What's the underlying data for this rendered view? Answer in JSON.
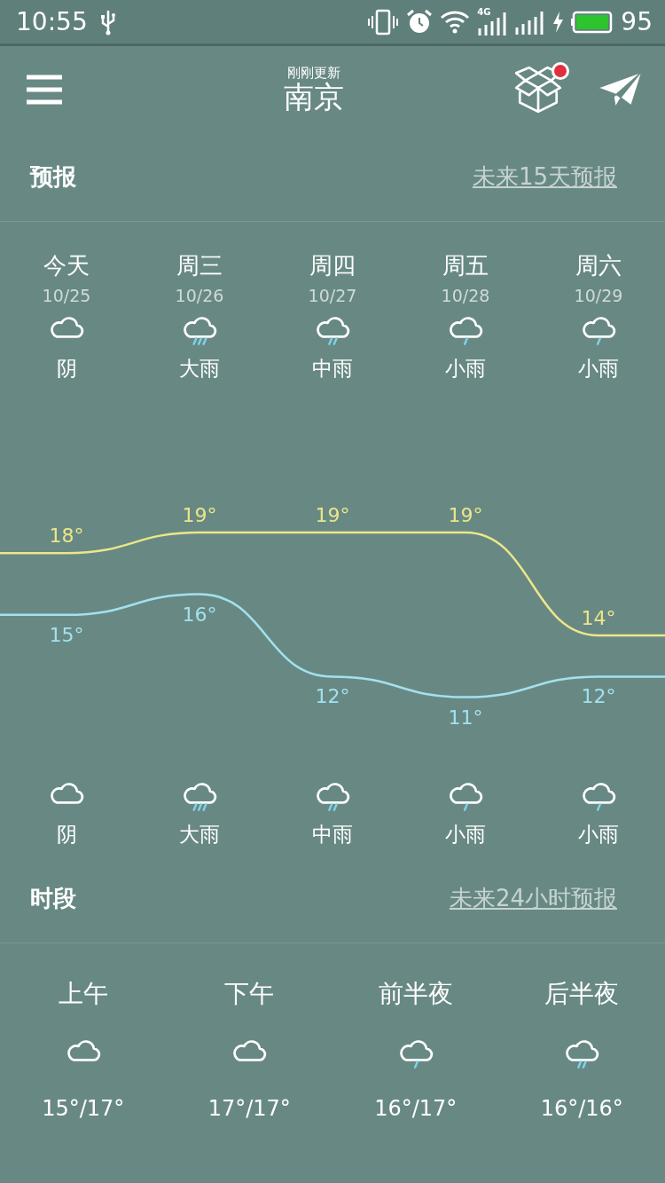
{
  "status_bar": {
    "time": "10:55",
    "network_label": "4G",
    "battery": "95"
  },
  "header": {
    "subtitle": "刚刚更新",
    "city": "南京",
    "badge": true
  },
  "forecast": {
    "title": "预报",
    "link": "未来15天预报",
    "days": [
      {
        "day": "今天",
        "date": "10/25",
        "kind": "cloudy",
        "weather": "阴"
      },
      {
        "day": "周三",
        "date": "10/26",
        "kind": "heavy-rain",
        "weather": "大雨"
      },
      {
        "day": "周四",
        "date": "10/27",
        "kind": "moderate-rain",
        "weather": "中雨"
      },
      {
        "day": "周五",
        "date": "10/28",
        "kind": "light-rain",
        "weather": "小雨"
      },
      {
        "day": "周六",
        "date": "10/29",
        "kind": "light-rain",
        "weather": "小雨"
      }
    ],
    "chart_data": {
      "type": "line",
      "data_labels": true,
      "series": [
        {
          "color": "#ece68a",
          "values": [
            18,
            19,
            19,
            19,
            14
          ],
          "value_labels": [
            "18°",
            "19°",
            "19°",
            "19°",
            "14°"
          ]
        },
        {
          "color": "#a3e1ef",
          "values": [
            15,
            16,
            12,
            11,
            12
          ],
          "value_labels": [
            "15°",
            "16°",
            "12°",
            "11°",
            "12°"
          ]
        }
      ]
    },
    "night": [
      {
        "kind": "cloudy",
        "weather": "阴"
      },
      {
        "kind": "heavy-rain",
        "weather": "大雨"
      },
      {
        "kind": "moderate-rain",
        "weather": "中雨"
      },
      {
        "kind": "light-rain",
        "weather": "小雨"
      },
      {
        "kind": "light-rain",
        "weather": "小雨"
      }
    ]
  },
  "hours": {
    "title": "时段",
    "link": "未来24小时预报",
    "periods": [
      {
        "label": "上午",
        "kind": "cloudy",
        "temps": "15°/17°"
      },
      {
        "label": "下午",
        "kind": "cloudy",
        "temps": "17°/17°"
      },
      {
        "label": "前半夜",
        "kind": "light-rain",
        "temps": "16°/17°"
      },
      {
        "label": "后半夜",
        "kind": "moderate-rain",
        "temps": "16°/16°"
      }
    ]
  }
}
